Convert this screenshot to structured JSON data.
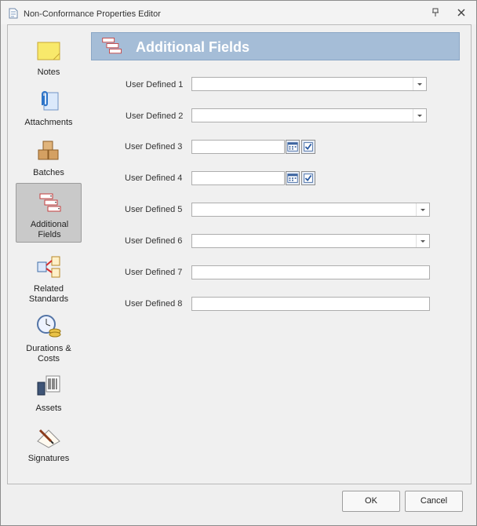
{
  "window": {
    "title": "Non-Conformance Properties Editor",
    "icon": "document-icon"
  },
  "sidebar": {
    "items": [
      {
        "label": "Notes",
        "icon": "sticky-note-icon",
        "active": false
      },
      {
        "label": "Attachments",
        "icon": "paperclip-icon",
        "active": false
      },
      {
        "label": "Batches",
        "icon": "boxes-icon",
        "active": false
      },
      {
        "label": "Additional\nFields",
        "icon": "fields-icon",
        "active": true
      },
      {
        "label": "Related\nStandards",
        "icon": "related-standards-icon",
        "active": false
      },
      {
        "label": "Durations &\nCosts",
        "icon": "clock-coins-icon",
        "active": false
      },
      {
        "label": "Assets",
        "icon": "assets-icon",
        "active": false
      },
      {
        "label": "Signatures",
        "icon": "signature-icon",
        "active": false
      }
    ]
  },
  "header": {
    "title": "Additional Fields",
    "icon": "fields-icon"
  },
  "fields": [
    {
      "label": "User Defined 1",
      "type": "dropdown",
      "value": ""
    },
    {
      "label": "User Defined 2",
      "type": "dropdown",
      "value": ""
    },
    {
      "label": "User Defined 3",
      "type": "date",
      "value": ""
    },
    {
      "label": "User Defined 4",
      "type": "date",
      "value": ""
    },
    {
      "label": "User Defined 5",
      "type": "dropdown",
      "value": ""
    },
    {
      "label": "User Defined 6",
      "type": "dropdown",
      "value": ""
    },
    {
      "label": "User Defined 7",
      "type": "text",
      "value": ""
    },
    {
      "label": "User Defined 8",
      "type": "text",
      "value": ""
    }
  ],
  "footer": {
    "ok_label": "OK",
    "cancel_label": "Cancel"
  },
  "colors": {
    "header_bg": "#a5bdd7",
    "active_nav_bg": "#c9c9c9",
    "window_bg": "#efefef"
  }
}
